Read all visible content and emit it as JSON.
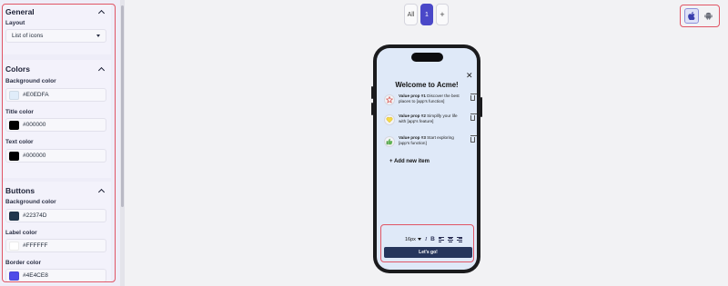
{
  "sidebar": {
    "general": {
      "title": "General",
      "layout_label": "Layout",
      "layout_value": "List of icons"
    },
    "colors": {
      "title": "Colors",
      "background_label": "Background color",
      "background_value": "#E0EDFA",
      "title_color_label": "Title color",
      "title_color_value": "#000000",
      "text_color_label": "Text color",
      "text_color_value": "#000000"
    },
    "buttons": {
      "title": "Buttons",
      "background_label": "Background color",
      "background_value": "#22374D",
      "label_color_label": "Label color",
      "label_color_value": "#FFFFFF",
      "border_color_label": "Border color",
      "border_color_value": "#4E4CE8"
    }
  },
  "variants": {
    "all_label": "All",
    "active_label": "1",
    "add_label": "+"
  },
  "platform_toggle": {
    "ios_icon": "apple-icon",
    "android_icon": "android-icon",
    "selected": "ios"
  },
  "preview": {
    "close_glyph": "✕",
    "title": "Welcome to Acme!",
    "items": [
      {
        "icon": "star-icon",
        "bold": "Value prop #1",
        "text": " Discover the best places to [app's function]"
      },
      {
        "icon": "heart-icon",
        "bold": "Value prop #2",
        "text": " Simplify your life with [app's feature]"
      },
      {
        "icon": "thumbs-up-icon",
        "bold": "Value prop #3",
        "text": " Start exploring [app's function]"
      }
    ],
    "add_item_label": "+ Add new item",
    "toolbar": {
      "font_size": "16px",
      "italic": "I",
      "bold": "B"
    },
    "cta_label": "Let's go!"
  },
  "colors": {
    "accent": "#4A48C8",
    "highlight_frame": "#E05565",
    "screen_background": "#E0EDFA",
    "button_background": "#22374D"
  }
}
